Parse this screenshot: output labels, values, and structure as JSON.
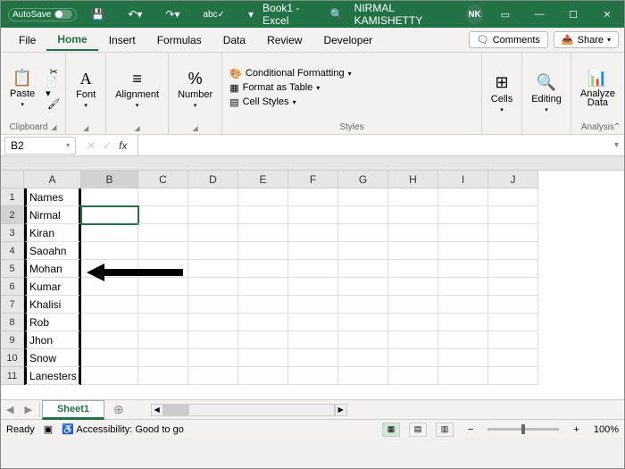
{
  "titlebar": {
    "autosave_label": "AutoSave",
    "title": "Book1 - Excel",
    "user_name": "NIRMAL KAMISHETTY",
    "user_initials": "NK"
  },
  "tabs": {
    "file": "File",
    "home": "Home",
    "insert": "Insert",
    "formulas": "Formulas",
    "data": "Data",
    "review": "Review",
    "developer": "Developer",
    "comments": "Comments",
    "share": "Share"
  },
  "ribbon": {
    "clipboard_label": "Clipboard",
    "paste": "Paste",
    "font": "Font",
    "alignment": "Alignment",
    "number": "Number",
    "styles_label": "Styles",
    "cond_format": "Conditional Formatting",
    "format_table": "Format as Table",
    "cell_styles": "Cell Styles",
    "cells": "Cells",
    "editing": "Editing",
    "analyze": "Analyze",
    "analyze_data": "Data",
    "analysis_label": "Analysis"
  },
  "formula_bar": {
    "name_box": "B2"
  },
  "columns": [
    "A",
    "B",
    "C",
    "D",
    "E",
    "F",
    "G",
    "H",
    "I",
    "J"
  ],
  "rows": [
    "1",
    "2",
    "3",
    "4",
    "5",
    "6",
    "7",
    "8",
    "9",
    "10",
    "11"
  ],
  "cells": {
    "A1": "Names",
    "A2": "Nirmal",
    "A3": "Kiran",
    "A4": "Saoahn",
    "A5": "Mohan",
    "A6": "Kumar",
    "A7": "Khalisi",
    "A8": "Rob",
    "A9": "Jhon",
    "A10": "Snow",
    "A11": "Lanesters"
  },
  "sheet": {
    "name": "Sheet1"
  },
  "status": {
    "ready": "Ready",
    "accessibility": "Accessibility: Good to go",
    "zoom": "100%"
  }
}
